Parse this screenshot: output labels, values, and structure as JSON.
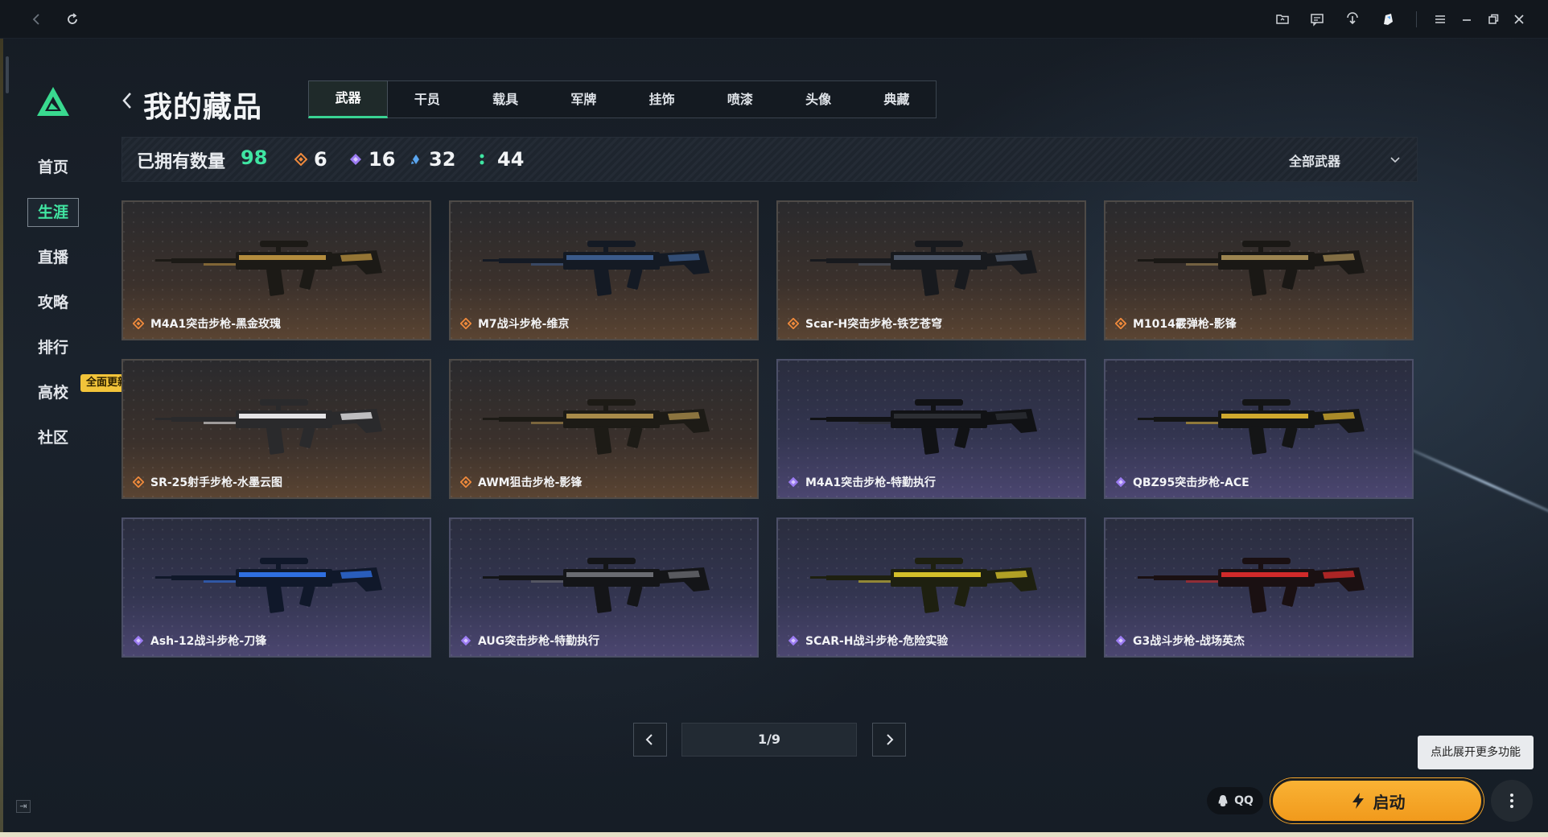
{
  "topbar": {
    "icons": [
      "back-icon",
      "refresh-icon",
      "folder-icon",
      "message-icon",
      "download-icon",
      "avatar-icon",
      "menu-icon",
      "minimize-icon",
      "restore-icon",
      "close-icon"
    ]
  },
  "sidebar": {
    "items": [
      {
        "label": "首页"
      },
      {
        "label": "生涯"
      },
      {
        "label": "直播"
      },
      {
        "label": "攻略"
      },
      {
        "label": "排行"
      },
      {
        "label": "高校"
      },
      {
        "label": "社区"
      }
    ],
    "active_index": 1,
    "badge": "全面更新"
  },
  "header": {
    "title": "我的藏品",
    "tabs": [
      "武器",
      "干员",
      "载具",
      "军牌",
      "挂饰",
      "喷漆",
      "头像",
      "典藏"
    ],
    "active_tab": 0
  },
  "stats": {
    "label": "已拥有数量",
    "total": "98",
    "rarity_counts": [
      {
        "color": "#f08a3c",
        "value": "6"
      },
      {
        "color": "#9b7bf2",
        "value": "16"
      },
      {
        "color": "#5aa6f0",
        "value": "32"
      },
      {
        "color": "#3fe6a3",
        "value": "44"
      }
    ],
    "filter": "全部武器"
  },
  "items": [
    {
      "name": "M4A1突击步枪-黑金玫瑰",
      "rarity": "orange",
      "palette": [
        "#1c1a16",
        "#b38c3d"
      ]
    },
    {
      "name": "M7战斗步枪-维京",
      "rarity": "orange",
      "palette": [
        "#141a24",
        "#3a5a8a"
      ]
    },
    {
      "name": "Scar-H突击步枪-铁艺苍穹",
      "rarity": "orange",
      "palette": [
        "#181a1e",
        "#4b5566"
      ]
    },
    {
      "name": "M1014霰弹枪-影锋",
      "rarity": "orange",
      "palette": [
        "#1a1815",
        "#9c8450"
      ]
    },
    {
      "name": "SR-25射手步枪-水墨云图",
      "rarity": "orange",
      "palette": [
        "#2a2a2c",
        "#e4e4e6"
      ]
    },
    {
      "name": "AWM狙击步枪-影锋",
      "rarity": "orange",
      "palette": [
        "#1d1b16",
        "#a88b4a"
      ]
    },
    {
      "name": "M4A1突击步枪-特勤执行",
      "rarity": "purple",
      "palette": [
        "#111215",
        "#2c2e33"
      ]
    },
    {
      "name": "QBZ95突击步枪-ACE",
      "rarity": "purple",
      "palette": [
        "#141516",
        "#d0a92e"
      ]
    },
    {
      "name": "Ash-12战斗步枪-刀锋",
      "rarity": "purple",
      "palette": [
        "#10182a",
        "#2f6fe0"
      ]
    },
    {
      "name": "AUG突击步枪-特勤执行",
      "rarity": "purple",
      "palette": [
        "#141518",
        "#6a6c72"
      ]
    },
    {
      "name": "SCAR-H战斗步枪-危险实验",
      "rarity": "purple",
      "palette": [
        "#1e2010",
        "#d4c02a"
      ]
    },
    {
      "name": "G3战斗步枪-战场英杰",
      "rarity": "purple",
      "palette": [
        "#1a1012",
        "#d02a2a"
      ]
    }
  ],
  "pagination": {
    "current": 1,
    "total": 9,
    "text": "1/9"
  },
  "footer": {
    "tooltip": "点此展开更多功能",
    "qq_label": "QQ",
    "launch_label": "启动",
    "accent": "#f6a62a"
  }
}
